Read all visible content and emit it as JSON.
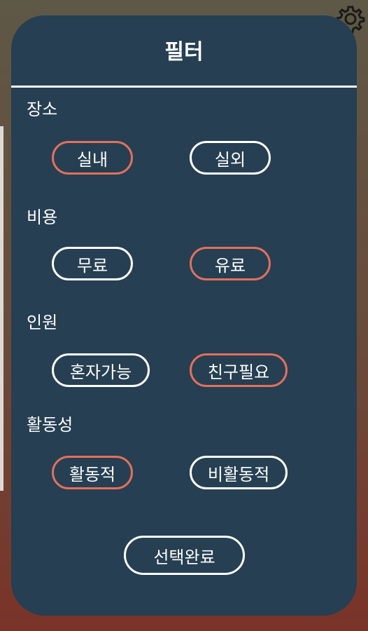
{
  "dialog": {
    "title": "필터",
    "done_label": "선택완료"
  },
  "colors": {
    "panel": "#263f52",
    "chip_border_default": "#ffffff",
    "chip_border_selected": "#e3705c"
  },
  "sections": [
    {
      "label": "장소",
      "options": [
        {
          "label": "실내",
          "selected": true
        },
        {
          "label": "실외",
          "selected": false
        }
      ]
    },
    {
      "label": "비용",
      "options": [
        {
          "label": "무료",
          "selected": false
        },
        {
          "label": "유료",
          "selected": true
        }
      ]
    },
    {
      "label": "인원",
      "options": [
        {
          "label": "혼자가능",
          "selected": false
        },
        {
          "label": "친구필요",
          "selected": true
        }
      ]
    },
    {
      "label": "활동성",
      "options": [
        {
          "label": "활동적",
          "selected": true
        },
        {
          "label": "비활동적",
          "selected": false
        }
      ]
    }
  ],
  "icons": {
    "settings": "gear-icon"
  }
}
